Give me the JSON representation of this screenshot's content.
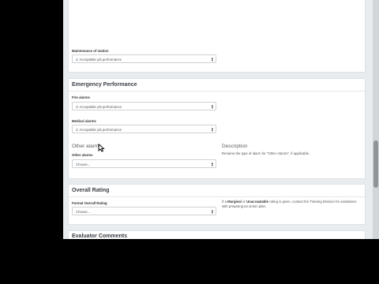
{
  "maintenance": {
    "label": "Maintenance of station",
    "value": "4: Acceptable job performance"
  },
  "emergency": {
    "title": "Emergency Performance",
    "fire": {
      "label": "Fire alarms",
      "value": "4: Acceptable job performance"
    },
    "medical": {
      "label": "Medical alarms",
      "value": "4: Acceptable job performance"
    },
    "other": {
      "heading": "Other alarms",
      "label": "Other alarms",
      "placeholder": "Choose...",
      "description_heading": "Description",
      "description_text": "Rename the type of alarm for \"Other Alarms\", if applicable."
    }
  },
  "overall": {
    "title": "Overall Rating",
    "label": "Formal Overall Rating",
    "placeholder": "Choose...",
    "help_pre": "If a ",
    "help_bold1": "Marginal",
    "help_mid": " or ",
    "help_bold2": "Unacceptable",
    "help_post": " rating is given, contact the Training Division for assistance with preparing an action plan."
  },
  "evaluator": {
    "title": "Evaluator Comments"
  },
  "icons": {
    "caret": "select-caret-icon",
    "cursor": "mouse-pointer-icon"
  },
  "colors": {
    "page_bg": "#e9ecef",
    "card_bg": "#ffffff",
    "letterbox": "#000000"
  }
}
